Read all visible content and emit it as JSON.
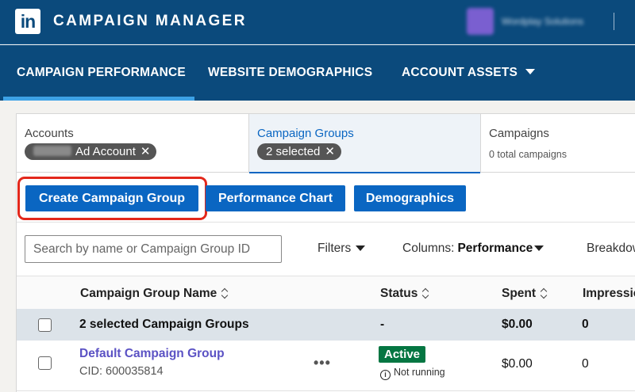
{
  "app": {
    "logo_text": "in",
    "title": "CAMPAIGN MANAGER",
    "account_name": "Wordplay Solutions"
  },
  "nav": {
    "items": [
      {
        "label": "CAMPAIGN PERFORMANCE",
        "active": true
      },
      {
        "label": "WEBSITE DEMOGRAPHICS",
        "active": false
      },
      {
        "label": "ACCOUNT ASSETS",
        "active": false
      }
    ]
  },
  "tabs": {
    "accounts": {
      "title": "Accounts",
      "pill_label": "Ad Account",
      "pill_remove": "✕"
    },
    "campaign_groups": {
      "title": "Campaign Groups",
      "pill_label": "2 selected",
      "pill_remove": "✕"
    },
    "campaigns": {
      "title": "Campaigns",
      "subtitle": "0 total campaigns"
    }
  },
  "actions": {
    "create": "Create Campaign Group",
    "performance_chart": "Performance Chart",
    "demographics": "Demographics"
  },
  "toolbar": {
    "search_placeholder": "Search by name or Campaign Group ID",
    "filters": "Filters",
    "columns_label": "Columns:",
    "columns_value": "Performance",
    "breakdown": "Breakdown"
  },
  "table": {
    "headers": {
      "name": "Campaign Group Name",
      "status": "Status",
      "spent": "Spent",
      "impressions": "Impressions"
    },
    "summary": {
      "name": "2 selected Campaign Groups",
      "status": "-",
      "spent": "$0.00",
      "impressions": "0"
    },
    "rows": [
      {
        "name": "Default Campaign Group",
        "cid": "CID: 600035814",
        "menu": "•••",
        "status": "Active",
        "status_note": "Not running",
        "spent": "$0.00",
        "impressions": "0"
      }
    ]
  },
  "colors": {
    "header_bg": "#0b4a7c",
    "primary": "#0a66c2",
    "active_badge": "#057642",
    "highlight": "#e3281b",
    "link": "#5b52c4"
  }
}
